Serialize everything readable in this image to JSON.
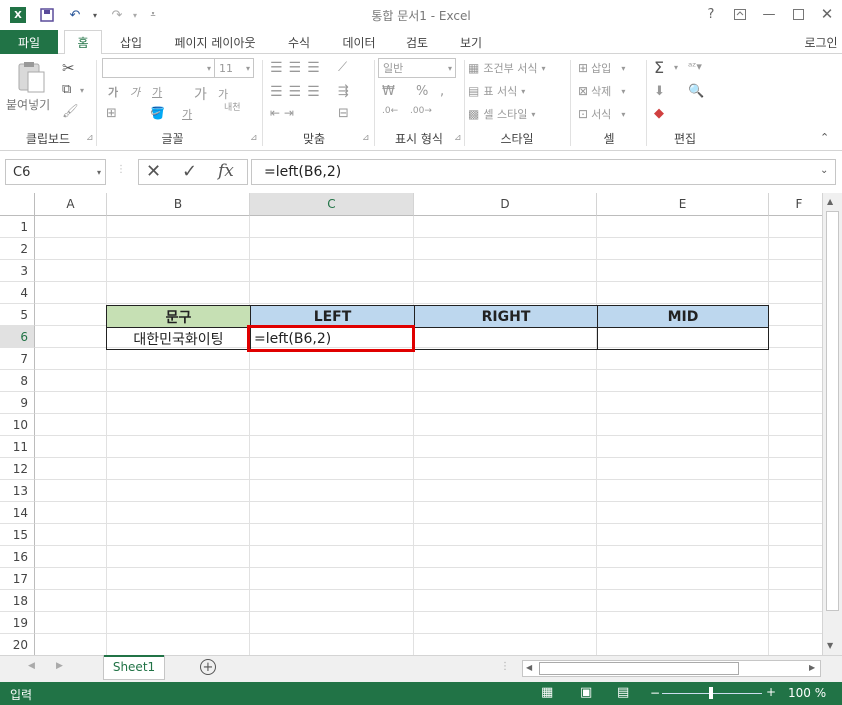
{
  "window": {
    "title": "통합 문서1 - Excel"
  },
  "tabs": [
    "파일",
    "홈",
    "삽입",
    "페이지 레이아웃",
    "수식",
    "데이터",
    "검토",
    "보기"
  ],
  "account": "로그인",
  "ribbon": {
    "groups": [
      "클립보드",
      "글꼴",
      "맞춤",
      "표시 형식",
      "스타일",
      "셀",
      "편집"
    ],
    "paste_label": "붙여넣기",
    "font_size": "11",
    "number_format": "일반",
    "style_items": [
      "조건부 서식",
      "표 서식",
      "셀 스타일"
    ],
    "cell_items": [
      "삽입",
      "삭제",
      "서식"
    ],
    "font_glyphs": [
      "가",
      "가",
      "가",
      "가",
      "가"
    ],
    "wrap_glyph": "내천",
    "number_glyphs": [
      "%"
    ]
  },
  "formula_bar": {
    "name_box": "C6",
    "formula": "=left(B6,2)",
    "fx": "fx"
  },
  "columns": [
    "A",
    "B",
    "C",
    "D",
    "E",
    "F"
  ],
  "rows": [
    "1",
    "2",
    "3",
    "4",
    "5",
    "6",
    "7",
    "8",
    "9",
    "10",
    "11",
    "12",
    "13",
    "14",
    "15",
    "16",
    "17",
    "18",
    "19",
    "20"
  ],
  "table": {
    "headers": [
      "문구",
      "LEFT",
      "RIGHT",
      "MID"
    ],
    "row6": [
      "대한민국화이팅",
      "=left(B6,2)",
      "",
      ""
    ]
  },
  "sheets": [
    "Sheet1"
  ],
  "status": {
    "mode": "입력",
    "zoom": "100 %"
  },
  "colors": {
    "accent": "#217346",
    "header_b": "#c6e0b4",
    "header_cde": "#bdd7ee",
    "selection": "#e00000"
  }
}
